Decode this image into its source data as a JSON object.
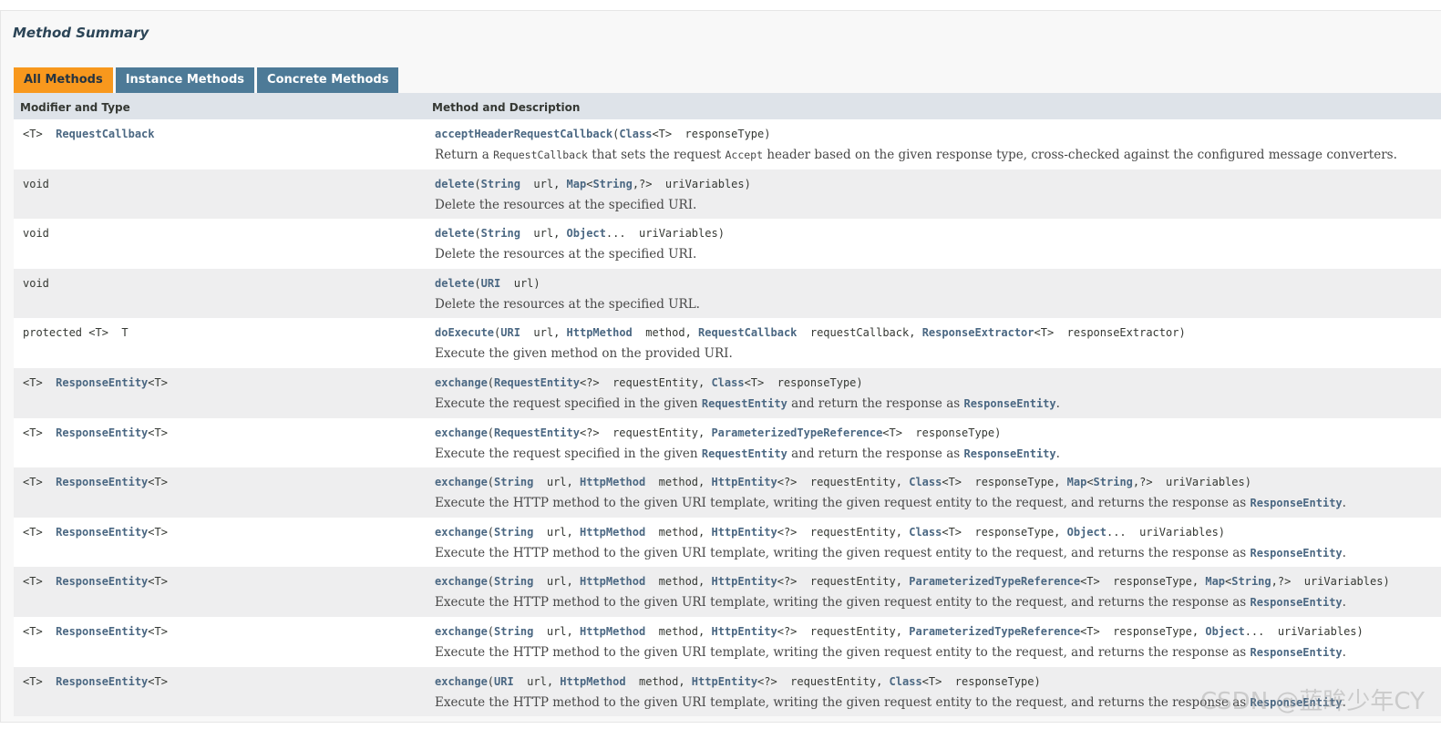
{
  "summary_title": "Method Summary",
  "tabs": [
    {
      "label": "All Methods",
      "active": true
    },
    {
      "label": "Instance Methods",
      "active": false
    },
    {
      "label": "Concrete Methods",
      "active": false
    }
  ],
  "columns": {
    "modifier": "Modifier and Type",
    "method": "Method and Description"
  },
  "rows": [
    {
      "modifier": [
        {
          "t": "<T>  "
        },
        {
          "t": "RequestCallback",
          "link": true
        }
      ],
      "signature": [
        {
          "t": "acceptHeaderRequestCallback",
          "link": true
        },
        {
          "t": "("
        },
        {
          "t": "Class",
          "link": true
        },
        {
          "t": "<T>  responseType)"
        }
      ],
      "description": [
        {
          "t": "Return a "
        },
        {
          "t": "RequestCallback",
          "code": true
        },
        {
          "t": " that sets the request "
        },
        {
          "t": "Accept",
          "code": true
        },
        {
          "t": " header based on the given response type, cross-checked against the configured message converters."
        }
      ]
    },
    {
      "modifier": [
        {
          "t": "void"
        }
      ],
      "signature": [
        {
          "t": "delete",
          "link": true
        },
        {
          "t": "("
        },
        {
          "t": "String",
          "link": true
        },
        {
          "t": "  url, "
        },
        {
          "t": "Map",
          "link": true
        },
        {
          "t": "<"
        },
        {
          "t": "String",
          "link": true
        },
        {
          "t": ",?>  uriVariables)"
        }
      ],
      "description": [
        {
          "t": "Delete the resources at the specified URI."
        }
      ]
    },
    {
      "modifier": [
        {
          "t": "void"
        }
      ],
      "signature": [
        {
          "t": "delete",
          "link": true
        },
        {
          "t": "("
        },
        {
          "t": "String",
          "link": true
        },
        {
          "t": "  url, "
        },
        {
          "t": "Object",
          "link": true
        },
        {
          "t": "...  uriVariables)"
        }
      ],
      "description": [
        {
          "t": "Delete the resources at the specified URI."
        }
      ]
    },
    {
      "modifier": [
        {
          "t": "void"
        }
      ],
      "signature": [
        {
          "t": "delete",
          "link": true
        },
        {
          "t": "("
        },
        {
          "t": "URI",
          "link": true
        },
        {
          "t": "  url)"
        }
      ],
      "description": [
        {
          "t": "Delete the resources at the specified URL."
        }
      ]
    },
    {
      "modifier": [
        {
          "t": "protected <T>  T"
        }
      ],
      "signature": [
        {
          "t": "doExecute",
          "link": true
        },
        {
          "t": "("
        },
        {
          "t": "URI",
          "link": true
        },
        {
          "t": "  url, "
        },
        {
          "t": "HttpMethod",
          "link": true
        },
        {
          "t": "  method, "
        },
        {
          "t": "RequestCallback",
          "link": true
        },
        {
          "t": "  requestCallback, "
        },
        {
          "t": "ResponseExtractor",
          "link": true
        },
        {
          "t": "<T>  responseExtractor)"
        }
      ],
      "description": [
        {
          "t": "Execute the given method on the provided URI."
        }
      ]
    },
    {
      "modifier": [
        {
          "t": "<T>  "
        },
        {
          "t": "ResponseEntity",
          "link": true
        },
        {
          "t": "<T>"
        }
      ],
      "signature": [
        {
          "t": "exchange",
          "link": true
        },
        {
          "t": "("
        },
        {
          "t": "RequestEntity",
          "link": true
        },
        {
          "t": "<?>  requestEntity, "
        },
        {
          "t": "Class",
          "link": true
        },
        {
          "t": "<T>  responseType)"
        }
      ],
      "description": [
        {
          "t": "Execute the request specified in the given "
        },
        {
          "t": "RequestEntity",
          "link": true
        },
        {
          "t": " and return the response as "
        },
        {
          "t": "ResponseEntity",
          "link": true
        },
        {
          "t": "."
        }
      ]
    },
    {
      "modifier": [
        {
          "t": "<T>  "
        },
        {
          "t": "ResponseEntity",
          "link": true
        },
        {
          "t": "<T>"
        }
      ],
      "signature": [
        {
          "t": "exchange",
          "link": true
        },
        {
          "t": "("
        },
        {
          "t": "RequestEntity",
          "link": true
        },
        {
          "t": "<?>  requestEntity, "
        },
        {
          "t": "ParameterizedTypeReference",
          "link": true
        },
        {
          "t": "<T>  responseType)"
        }
      ],
      "description": [
        {
          "t": "Execute the request specified in the given "
        },
        {
          "t": "RequestEntity",
          "link": true
        },
        {
          "t": " and return the response as "
        },
        {
          "t": "ResponseEntity",
          "link": true
        },
        {
          "t": "."
        }
      ]
    },
    {
      "modifier": [
        {
          "t": "<T>  "
        },
        {
          "t": "ResponseEntity",
          "link": true
        },
        {
          "t": "<T>"
        }
      ],
      "signature": [
        {
          "t": "exchange",
          "link": true
        },
        {
          "t": "("
        },
        {
          "t": "String",
          "link": true
        },
        {
          "t": "  url, "
        },
        {
          "t": "HttpMethod",
          "link": true
        },
        {
          "t": "  method, "
        },
        {
          "t": "HttpEntity",
          "link": true
        },
        {
          "t": "<?>  requestEntity, "
        },
        {
          "t": "Class",
          "link": true
        },
        {
          "t": "<T>  responseType, "
        },
        {
          "t": "Map",
          "link": true
        },
        {
          "t": "<"
        },
        {
          "t": "String",
          "link": true
        },
        {
          "t": ",?>  uriVariables)"
        }
      ],
      "description": [
        {
          "t": "Execute the HTTP method to the given URI template, writing the given request entity to the request, and returns the response as "
        },
        {
          "t": "ResponseEntity",
          "link": true
        },
        {
          "t": "."
        }
      ]
    },
    {
      "modifier": [
        {
          "t": "<T>  "
        },
        {
          "t": "ResponseEntity",
          "link": true
        },
        {
          "t": "<T>"
        }
      ],
      "signature": [
        {
          "t": "exchange",
          "link": true
        },
        {
          "t": "("
        },
        {
          "t": "String",
          "link": true
        },
        {
          "t": "  url, "
        },
        {
          "t": "HttpMethod",
          "link": true
        },
        {
          "t": "  method, "
        },
        {
          "t": "HttpEntity",
          "link": true
        },
        {
          "t": "<?>  requestEntity, "
        },
        {
          "t": "Class",
          "link": true
        },
        {
          "t": "<T>  responseType, "
        },
        {
          "t": "Object",
          "link": true
        },
        {
          "t": "...  uriVariables)"
        }
      ],
      "description": [
        {
          "t": "Execute the HTTP method to the given URI template, writing the given request entity to the request, and returns the response as "
        },
        {
          "t": "ResponseEntity",
          "link": true
        },
        {
          "t": "."
        }
      ]
    },
    {
      "modifier": [
        {
          "t": "<T>  "
        },
        {
          "t": "ResponseEntity",
          "link": true
        },
        {
          "t": "<T>"
        }
      ],
      "signature": [
        {
          "t": "exchange",
          "link": true
        },
        {
          "t": "("
        },
        {
          "t": "String",
          "link": true
        },
        {
          "t": "  url, "
        },
        {
          "t": "HttpMethod",
          "link": true
        },
        {
          "t": "  method, "
        },
        {
          "t": "HttpEntity",
          "link": true
        },
        {
          "t": "<?>  requestEntity, "
        },
        {
          "t": "ParameterizedTypeReference",
          "link": true
        },
        {
          "t": "<T>  responseType, "
        },
        {
          "t": "Map",
          "link": true
        },
        {
          "t": "<"
        },
        {
          "t": "String",
          "link": true
        },
        {
          "t": ",?>  uriVariables)"
        }
      ],
      "description": [
        {
          "t": "Execute the HTTP method to the given URI template, writing the given request entity to the request, and returns the response as "
        },
        {
          "t": "ResponseEntity",
          "link": true
        },
        {
          "t": "."
        }
      ]
    },
    {
      "modifier": [
        {
          "t": "<T>  "
        },
        {
          "t": "ResponseEntity",
          "link": true
        },
        {
          "t": "<T>"
        }
      ],
      "signature": [
        {
          "t": "exchange",
          "link": true
        },
        {
          "t": "("
        },
        {
          "t": "String",
          "link": true
        },
        {
          "t": "  url, "
        },
        {
          "t": "HttpMethod",
          "link": true
        },
        {
          "t": "  method, "
        },
        {
          "t": "HttpEntity",
          "link": true
        },
        {
          "t": "<?>  requestEntity, "
        },
        {
          "t": "ParameterizedTypeReference",
          "link": true
        },
        {
          "t": "<T>  responseType, "
        },
        {
          "t": "Object",
          "link": true
        },
        {
          "t": "...  uriVariables)"
        }
      ],
      "description": [
        {
          "t": "Execute the HTTP method to the given URI template, writing the given request entity to the request, and returns the response as "
        },
        {
          "t": "ResponseEntity",
          "link": true
        },
        {
          "t": "."
        }
      ]
    },
    {
      "modifier": [
        {
          "t": "<T>  "
        },
        {
          "t": "ResponseEntity",
          "link": true
        },
        {
          "t": "<T>"
        }
      ],
      "signature": [
        {
          "t": "exchange",
          "link": true
        },
        {
          "t": "("
        },
        {
          "t": "URI",
          "link": true
        },
        {
          "t": "  url, "
        },
        {
          "t": "HttpMethod",
          "link": true
        },
        {
          "t": "  method, "
        },
        {
          "t": "HttpEntity",
          "link": true
        },
        {
          "t": "<?>  requestEntity, "
        },
        {
          "t": "Class",
          "link": true
        },
        {
          "t": "<T>  responseType)"
        }
      ],
      "description": [
        {
          "t": "Execute the HTTP method to the given URI template, writing the given request entity to the request, and returns the response as "
        },
        {
          "t": "ResponseEntity",
          "link": true
        },
        {
          "t": "."
        }
      ]
    }
  ],
  "watermark": "CSDN @蓝眸少年CY",
  "colors": {
    "tab_active": "#f8981d",
    "tab_inactive": "#4d7a97",
    "header_bg": "#dee3e9",
    "row_alt_bg": "#eeeeef",
    "link": "#4a6782"
  }
}
